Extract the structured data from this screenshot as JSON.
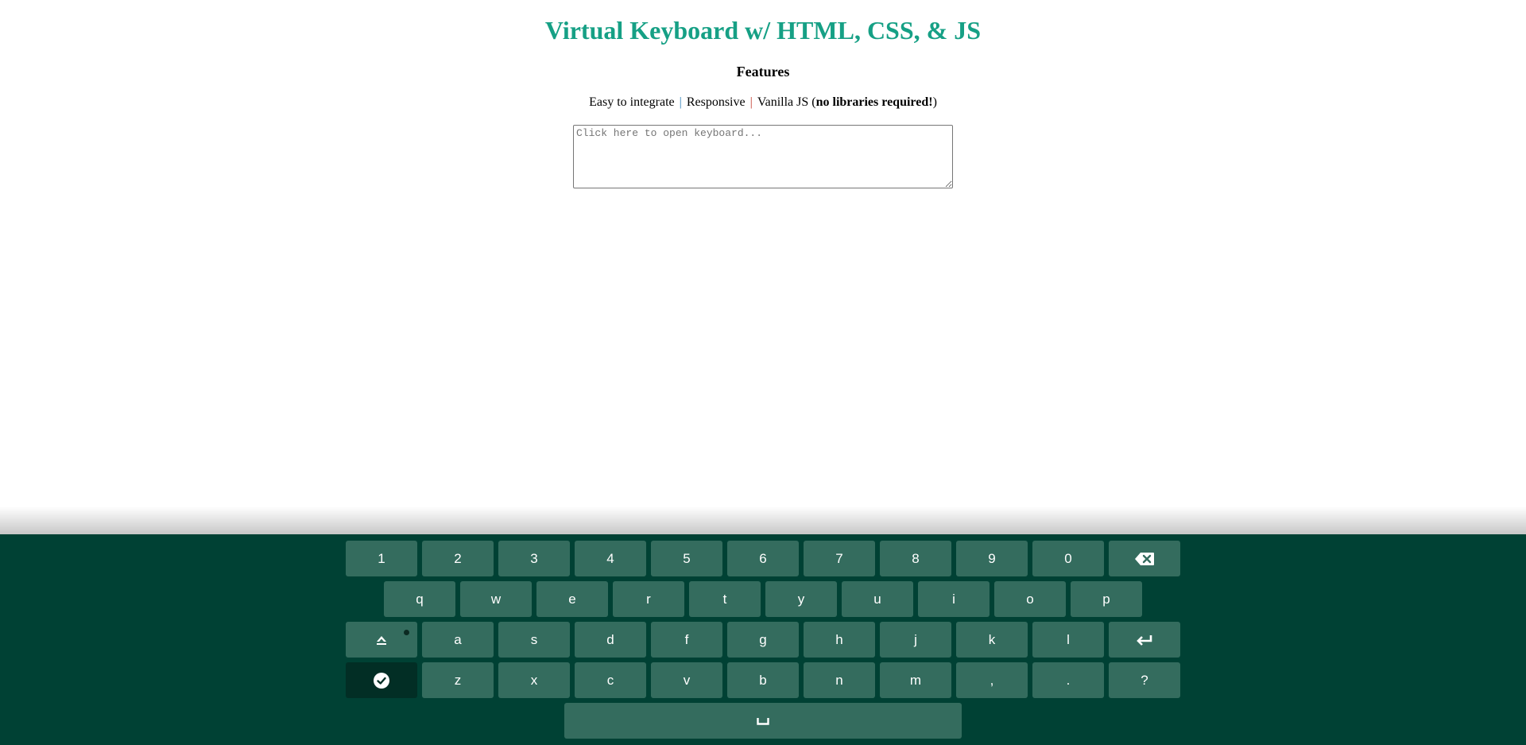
{
  "header": {
    "title": "Virtual Keyboard w/ HTML, CSS, & JS",
    "features_heading": "Features",
    "features": {
      "item1": "Easy to integrate",
      "separator": "|",
      "item2": "Responsive",
      "item3_prefix": "Vanilla JS (",
      "item3_bold": "no libraries required!",
      "item3_suffix": ")"
    }
  },
  "input": {
    "placeholder": "Click here to open keyboard...",
    "value": ""
  },
  "keyboard": {
    "row1": [
      "1",
      "2",
      "3",
      "4",
      "5",
      "6",
      "7",
      "8",
      "9",
      "0"
    ],
    "backspace_icon": "backspace-icon",
    "row2": [
      "q",
      "w",
      "e",
      "r",
      "t",
      "y",
      "u",
      "i",
      "o",
      "p"
    ],
    "caps_icon": "caps-lock-icon",
    "row3": [
      "a",
      "s",
      "d",
      "f",
      "g",
      "h",
      "j",
      "k",
      "l"
    ],
    "enter_icon": "enter-icon",
    "done_icon": "check-circle-icon",
    "row4": [
      "z",
      "x",
      "c",
      "v",
      "b",
      "n",
      "m",
      ",",
      ".",
      "?"
    ],
    "space_icon": "space-bar-icon"
  },
  "colors": {
    "title": "#16a085",
    "keyboard_bg": "#004134",
    "key_bg": "#346c5e",
    "done_key_bg": "#022e25",
    "key_text": "#ffffff"
  }
}
